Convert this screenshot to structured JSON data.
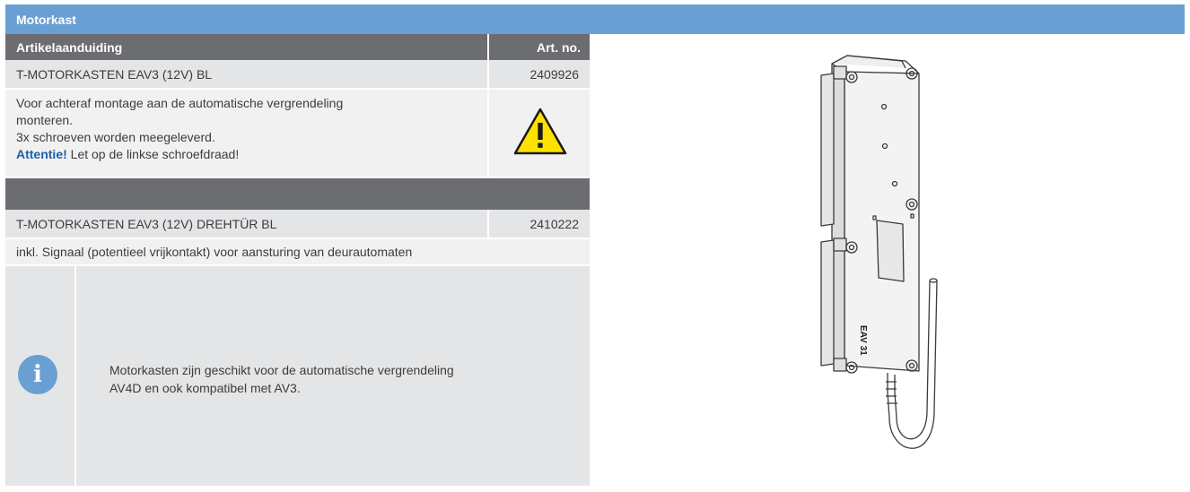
{
  "header": {
    "title": "Motorkast"
  },
  "table": {
    "col_article": "Artikelaanduiding",
    "col_artno": "Art. no."
  },
  "item1": {
    "name": "T-MOTORKASTEN EAV3 (12V) BL",
    "artno": "2409926",
    "desc_line1": "Voor achteraf montage aan de automatische vergrendeling",
    "desc_line2": "monteren.",
    "desc_line3": "3x schroeven worden meegeleverd.",
    "attention_label": "Attentie!",
    "attention_text": " Let op de linkse schroefdraad!",
    "warning_icon": "warning-triangle-icon"
  },
  "item2": {
    "name": "T-MOTORKASTEN EAV3 (12V) DREHTÜR BL",
    "artno": "2410222",
    "desc": "inkl. Signaal (potentieel vrijkontakt) voor aansturing van deurautomaten"
  },
  "info": {
    "icon": "info-icon",
    "line1": "Motorkasten zijn geschikt voor de automatische vergrendeling",
    "line2": "AV4D en ook kompatibel met AV3."
  },
  "product_image": {
    "label": "EAV 31"
  },
  "colors": {
    "header_blue": "#6a9fd4",
    "dark_gray": "#6c6d70",
    "row_gray": "#e4e5e6",
    "row_light": "#f1f1f2",
    "warning_yellow": "#ffe100",
    "attention_blue": "#1f5ea8"
  }
}
